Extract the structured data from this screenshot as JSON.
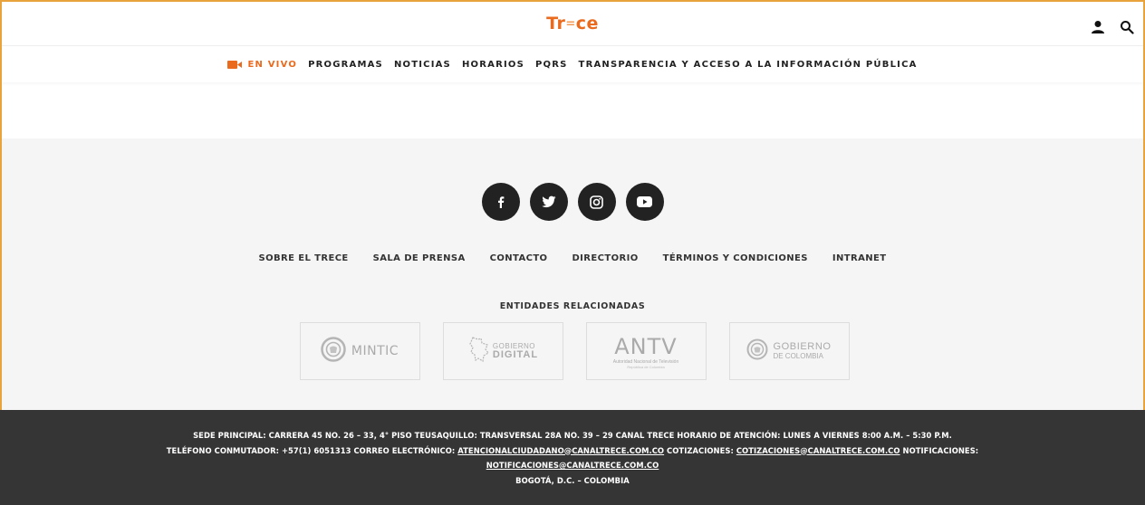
{
  "header": {
    "logo_left": "Tr",
    "logo_sep": "=",
    "logo_right": "ce"
  },
  "nav": {
    "live": "EN VIVO",
    "items": [
      "PROGRAMAS",
      "NOTICIAS",
      "HORARIOS",
      "PQRS",
      "TRANSPARENCIA Y ACCESO A LA INFORMACIÓN PÚBLICA"
    ]
  },
  "social": [
    "facebook-icon",
    "twitter-icon",
    "instagram-icon",
    "youtube-icon"
  ],
  "footer_links": [
    "SOBRE EL TRECE",
    "SALA DE PRENSA",
    "CONTACTO",
    "DIRECTORIO",
    "TÉRMINOS Y CONDICIONES",
    "INTRANET"
  ],
  "entities": {
    "title": "ENTIDADES RELACIONADAS",
    "mintic": "MINTIC",
    "gobdig_l1": "GOBIERNO",
    "gobdig_l2": "DIGITAL",
    "antv_big": "ANTV",
    "antv_small": "Autoridad Nacional de Televisión",
    "antv_tiny": "República de Colombia",
    "gobcol_l1": "GOBIERNO",
    "gobcol_l2": "DE COLOMBIA"
  },
  "footer_info": {
    "line1": "SEDE PRINCIPAL: CARRERA 45 NO. 26 – 33, 4° PISO TEUSAQUILLO: TRANSVERSAL 28A NO. 39 – 29 CANAL TRECE HORARIO DE ATENCIÓN: LUNES A VIERNES 8:00 A.M. – 5:30 P.M.",
    "phone_prefix": "TELÉFONO CONMUTADOR: +57(1) 6051313 CORREO ELECTRÓNICO: ",
    "email_citizen": "ATENCIONALCIUDADANO@CANALTRECE.COM.CO",
    "quotes_prefix": " COTIZACIONES: ",
    "email_quotes": "COTIZACIONES@CANALTRECE.COM.CO",
    "notif_prefix": " NOTIFICACIONES:",
    "email_notif": "NOTIFICACIONES@CANALTRECE.COM.CO",
    "city": "BOGOTÁ, D.C. – COLOMBIA"
  },
  "colors": {
    "accent": "#ea6a1e",
    "dark_footer": "#353535",
    "light_footer": "#f5f5f5",
    "frame_border": "#e8a33d"
  }
}
